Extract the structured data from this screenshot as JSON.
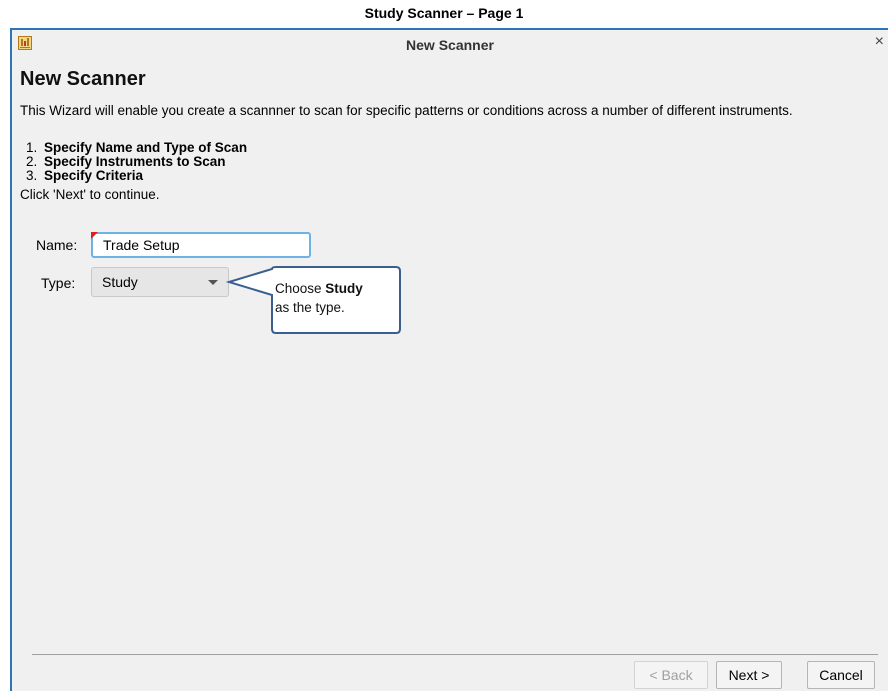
{
  "document": {
    "title": "Study Scanner – Page 1"
  },
  "window": {
    "title": "New Scanner",
    "close_symbol": "×",
    "icon": "app-logo-icon"
  },
  "wizard": {
    "heading": "New Scanner",
    "intro": "This Wizard will enable you create a scannner to scan for specific patterns or conditions across a number of different instruments.",
    "steps": [
      {
        "num": "1.",
        "label": "Specify Name and Type of Scan"
      },
      {
        "num": "2.",
        "label": "Specify Instruments to Scan"
      },
      {
        "num": "3.",
        "label": "Specify Criteria"
      }
    ],
    "continue_text": "Click 'Next' to continue."
  },
  "form": {
    "name_label": "Name:",
    "name_value": "Trade Setup",
    "type_label": "Type:",
    "type_value": "Study"
  },
  "callout": {
    "prefix": "Choose ",
    "bold": "Study",
    "suffix": "as the type."
  },
  "buttons": {
    "back": "< Back",
    "next": "Next >",
    "cancel": "Cancel"
  },
  "colors": {
    "window_border": "#2f75b5",
    "input_focus": "#6fb2e6",
    "callout_border": "#3a5f8f"
  }
}
